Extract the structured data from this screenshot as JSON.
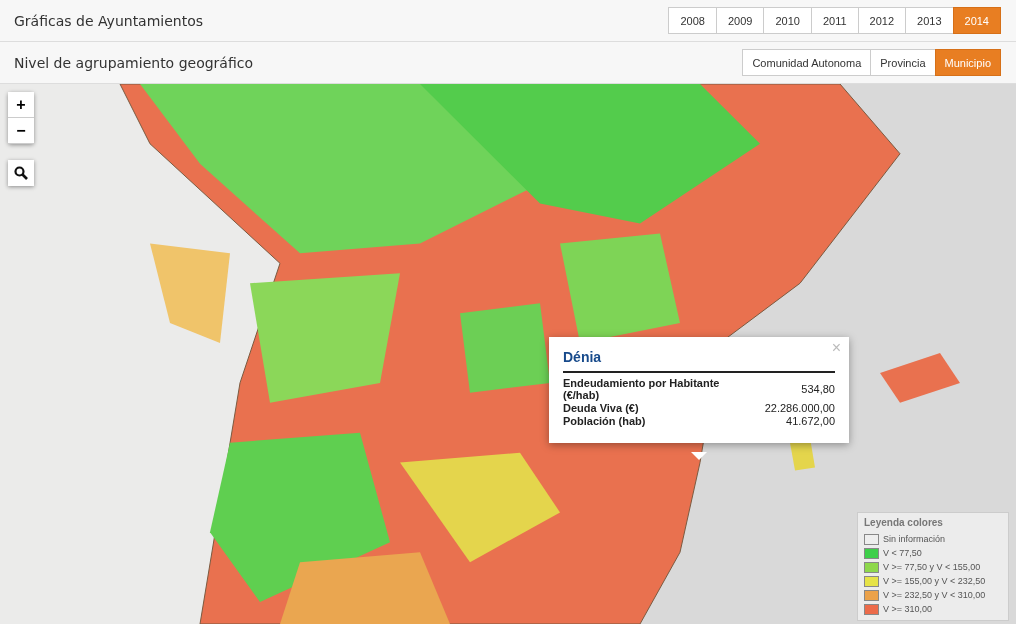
{
  "header": {
    "title": "Gráficas de Ayuntamientos",
    "years": [
      {
        "label": "2008",
        "selected": false
      },
      {
        "label": "2009",
        "selected": false
      },
      {
        "label": "2010",
        "selected": false
      },
      {
        "label": "2011",
        "selected": false
      },
      {
        "label": "2012",
        "selected": false
      },
      {
        "label": "2013",
        "selected": false
      },
      {
        "label": "2014",
        "selected": true
      }
    ]
  },
  "grouping": {
    "title": "Nivel de agrupamiento geográfico",
    "levels": [
      {
        "label": "Comunidad Autonoma",
        "selected": false
      },
      {
        "label": "Provincia",
        "selected": false
      },
      {
        "label": "Municipio",
        "selected": true
      }
    ]
  },
  "map": {
    "kind": "picture",
    "controls": [
      {
        "label": "+"
      },
      {
        "label": "−"
      }
    ],
    "popup": {
      "title": "Dénia",
      "close": "×",
      "rows": [
        {
          "label": "Endeudamiento por Habitante (€/hab)",
          "value": "534,80"
        },
        {
          "label": "Deuda Viva (€)",
          "value": "22.286.000,00"
        },
        {
          "label": "Población (hab)",
          "value": "41.672,00"
        }
      ]
    },
    "legend": {
      "title": "Leyenda colores",
      "items": [
        {
          "label": "Sin información",
          "color": "#eeeeee"
        },
        {
          "label": "V < 77,50",
          "color": "#3ecf4a"
        },
        {
          "label": "V >= 77,50 y V < 155,00",
          "color": "#8ed84c"
        },
        {
          "label": "V >= 155,00 y V < 232,50",
          "color": "#e6e347"
        },
        {
          "label": "V >= 232,50 y V < 310,00",
          "color": "#eba24a"
        },
        {
          "label": "V >= 310,00",
          "color": "#ec6b4a"
        }
      ]
    }
  }
}
